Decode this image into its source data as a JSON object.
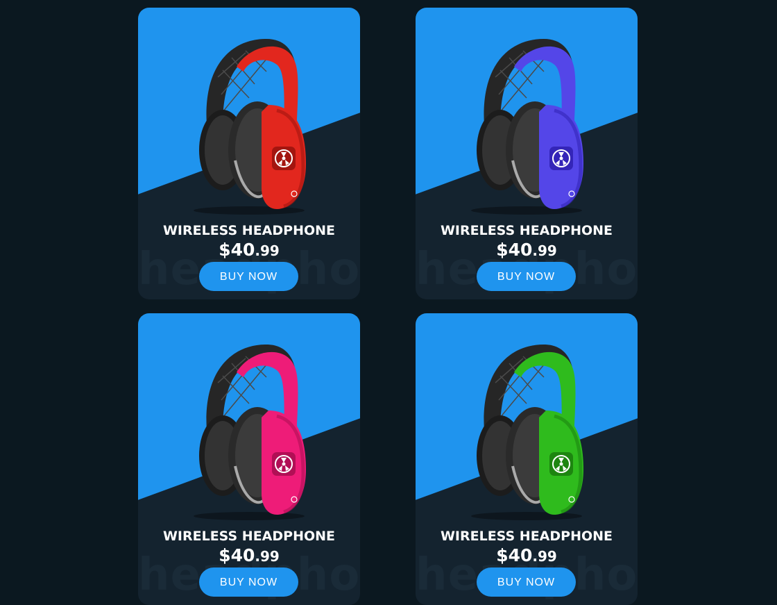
{
  "products": [
    {
      "title": "WIRELESS HEADPHONE",
      "price_main": "$40",
      "price_cents": ".99",
      "button": "BUY NOW",
      "watermark": "headphone",
      "color": "#e2271e",
      "color_dark": "#a3150f"
    },
    {
      "title": "WIRELESS HEADPHONE",
      "price_main": "$40",
      "price_cents": ".99",
      "button": "BUY NOW",
      "watermark": "headphone",
      "color": "#5446e8",
      "color_dark": "#3425b8"
    },
    {
      "title": "WIRELESS HEADPHONE",
      "price_main": "$40",
      "price_cents": ".99",
      "button": "BUY NOW",
      "watermark": "headphone",
      "color": "#ee1c78",
      "color_dark": "#b10f55"
    },
    {
      "title": "WIRELESS HEADPHONE",
      "price_main": "$40",
      "price_cents": ".99",
      "button": "BUY NOW",
      "watermark": "headphone",
      "color": "#2fbb1d",
      "color_dark": "#1d8510"
    }
  ],
  "theme": {
    "background": "#0b1820",
    "card": "#14232f",
    "accent": "#1f94ee"
  }
}
